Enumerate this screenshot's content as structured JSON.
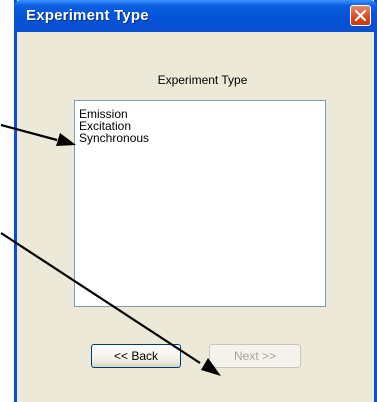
{
  "window": {
    "title": "Experiment Type"
  },
  "dialog": {
    "heading": "Experiment Type",
    "list_items": [
      {
        "label": "Emission"
      },
      {
        "label": "Excitation"
      },
      {
        "label": "Synchronous"
      }
    ]
  },
  "buttons": {
    "back_label": "<< Back",
    "next_label": "Next >>",
    "next_enabled": false
  },
  "colors": {
    "titlebar": "#0a4fd1",
    "dialog_bg": "#ece9d8",
    "close_button": "#d9481f",
    "annotation_arrow": "#000000"
  },
  "icons": {
    "close": "close-icon",
    "annotation_arrows": "arrow-icon"
  }
}
